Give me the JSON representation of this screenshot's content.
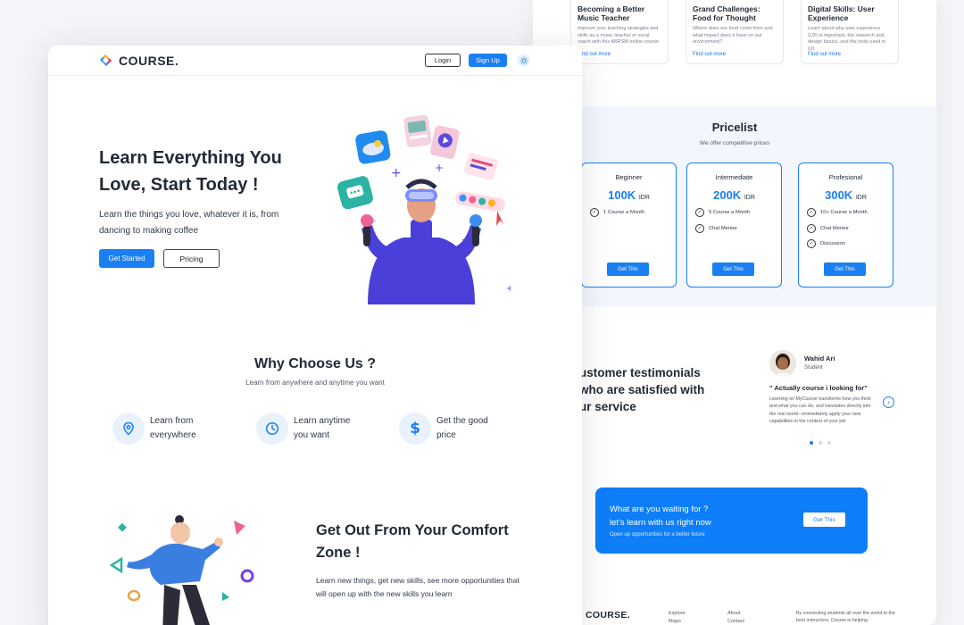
{
  "back": {
    "courses": [
      {
        "title": "Becoming a Better Music Teacher",
        "desc": "Improve your teaching strategies and skills as a music teacher or vocal coach with this ABRSM online course",
        "link": "Find out more"
      },
      {
        "title": "Grand Challenges: Food for Thought",
        "desc": "Where does our food come from and what impact does it have on our environment?",
        "link": "Find out more"
      },
      {
        "title": "Digital Skills: User Experience",
        "desc": "Learn about why user experience (UX) is important, the research and design basics, and the tools used in UX",
        "link": "Find out more"
      }
    ],
    "pricelist": {
      "title": "Pricelist",
      "subtitle": "We offer competitive prices",
      "plans": [
        {
          "name": "Beginner",
          "price": "100K",
          "currency": "IDR",
          "features": [
            "1 Course a Month"
          ],
          "button": "Get This"
        },
        {
          "name": "Intermediate",
          "price": "200K",
          "currency": "IDR",
          "features": [
            "5 Course a Month",
            "Chat Mentor"
          ],
          "button": "Get This"
        },
        {
          "name": "Profesional",
          "price": "300K",
          "currency": "IDR",
          "features": [
            "10+ Course a Month",
            "Chat Mentor",
            "Discussion"
          ],
          "button": "Get This"
        }
      ]
    },
    "testimonials": {
      "line1": "ustomer testimonials",
      "line2": "who are satisfied with",
      "line3": "ur service",
      "name": "Wahid Ari",
      "role": "Student",
      "quote": "\" Actually course i looking for\"",
      "body": "Learning on MyCourse transforms how you think and what you can do, and translates directly into the real world—immediately apply your new capabilities in the context of your job"
    },
    "cta": {
      "line1": "What are you waiting for ?",
      "line2": "let's learn with us right now",
      "sub": "Open up opportunities for a better future",
      "button": "Get This"
    },
    "footer": {
      "logo": "COURSE.",
      "col1": [
        "Explore",
        "Mapo"
      ],
      "col2": [
        "About",
        "Contact"
      ],
      "text": "By connecting students all over the world to the best instructors, Course is helping"
    }
  },
  "front": {
    "nav": {
      "logo": "COURSE.",
      "login": "Login",
      "signup": "Sign Up"
    },
    "hero": {
      "title": "Learn Everything You Love, Start Today !",
      "subtitle": "Learn the things you love, whatever it is, from dancing to making coffee",
      "start": "Get Started",
      "pricing": "Pricing"
    },
    "why": {
      "title": "Why Choose Us ?",
      "subtitle": "Learn from anywhere and anytime you want",
      "features": [
        {
          "icon": "location-pin-icon",
          "label": "Learn from everywhere"
        },
        {
          "icon": "clock-icon",
          "label": "Learn anytime you want"
        },
        {
          "icon": "dollar-icon",
          "label": "Get the good price"
        }
      ]
    },
    "comfort": {
      "title": "Get Out From Your Comfort Zone !",
      "subtitle": "Learn new things, get new skills, see more opportunities that will open up with the new skills you learn"
    }
  },
  "colors": {
    "accent": "#1a7ff2",
    "background": "#f4f5f8",
    "text": "#222a36",
    "figure": "#4a3fd8"
  }
}
